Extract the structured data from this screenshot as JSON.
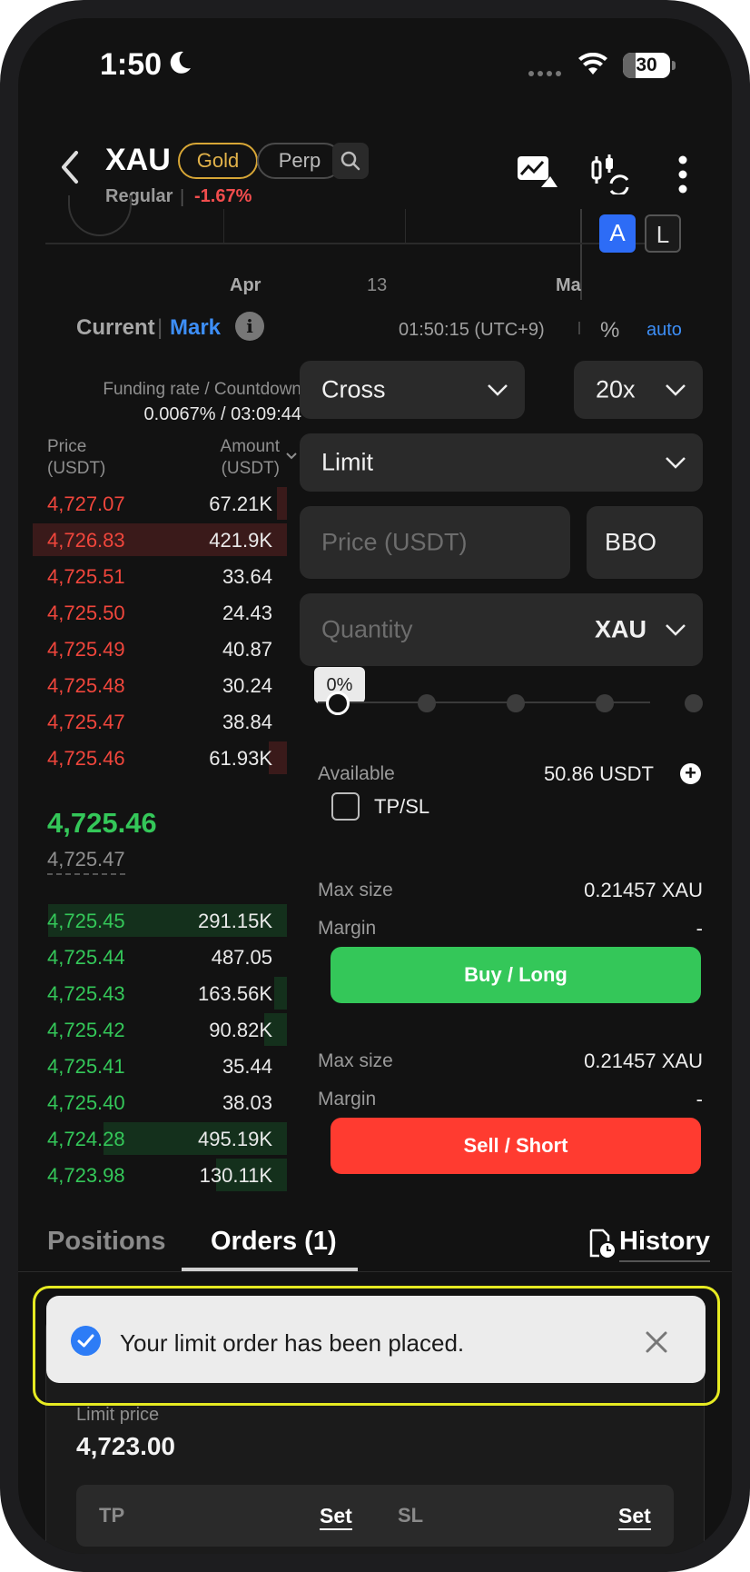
{
  "status_bar": {
    "time": "1:50",
    "battery": "30"
  },
  "header": {
    "symbol": "XAU",
    "tag_gold": "Gold",
    "tag_perp": "Perp",
    "session": "Regular",
    "change": "-1.67%"
  },
  "chart": {
    "x_labels": [
      "Apr",
      "13",
      "Ma"
    ],
    "indicator_a": "A",
    "indicator_l": "L"
  },
  "price_mode": {
    "current": "Current",
    "mark": "Mark",
    "time": "01:50:15 (UTC+9)",
    "percent": "%",
    "auto": "auto"
  },
  "orderbook": {
    "funding_title": "Funding rate / Countdown",
    "funding_value": "0.0067% / 03:09:44",
    "col_price": [
      "Price",
      "(USDT)"
    ],
    "col_amount": [
      "Amount",
      "(USDT)"
    ],
    "asks": [
      {
        "price": "4,727.07",
        "amount": "67.21K",
        "depth": 0.04
      },
      {
        "price": "4,726.83",
        "amount": "421.9K",
        "depth": 1.0
      },
      {
        "price": "4,725.51",
        "amount": "33.64",
        "depth": 0.0
      },
      {
        "price": "4,725.50",
        "amount": "24.43",
        "depth": 0.0
      },
      {
        "price": "4,725.49",
        "amount": "40.87",
        "depth": 0.0
      },
      {
        "price": "4,725.48",
        "amount": "30.24",
        "depth": 0.0
      },
      {
        "price": "4,725.47",
        "amount": "38.84",
        "depth": 0.0
      },
      {
        "price": "4,725.46",
        "amount": "61.93K",
        "depth": 0.07
      }
    ],
    "last_price": "4,725.46",
    "mark_price": "4,725.47",
    "bids": [
      {
        "price": "4,725.45",
        "amount": "291.15K",
        "depth": 0.94
      },
      {
        "price": "4,725.44",
        "amount": "487.05",
        "depth": 0.0
      },
      {
        "price": "4,725.43",
        "amount": "163.56K",
        "depth": 0.05
      },
      {
        "price": "4,725.42",
        "amount": "90.82K",
        "depth": 0.09
      },
      {
        "price": "4,725.41",
        "amount": "35.44",
        "depth": 0.0
      },
      {
        "price": "4,725.40",
        "amount": "38.03",
        "depth": 0.0
      },
      {
        "price": "4,724.28",
        "amount": "495.19K",
        "depth": 0.72
      },
      {
        "price": "4,723.98",
        "amount": "130.11K",
        "depth": 0.28
      }
    ]
  },
  "order_form": {
    "margin_mode": "Cross",
    "leverage": "20x",
    "order_type": "Limit",
    "price_placeholder": "Price (USDT)",
    "bbo": "BBO",
    "quantity_placeholder": "Quantity",
    "quantity_unit": "XAU",
    "slider_percent": "0%",
    "available_label": "Available",
    "available_value": "50.86 USDT",
    "tpsl_label": "TP/SL",
    "buy": {
      "max_size_label": "Max size",
      "max_size_value": "0.21457 XAU",
      "margin_label": "Margin",
      "margin_value": "-",
      "button": "Buy / Long"
    },
    "sell": {
      "max_size_label": "Max size",
      "max_size_value": "0.21457 XAU",
      "margin_label": "Margin",
      "margin_value": "-",
      "button": "Sell / Short"
    }
  },
  "tabs": {
    "positions": "Positions",
    "orders": "Orders (1)",
    "history": "History"
  },
  "order_card": {
    "limit_price_label": "Limit price",
    "limit_price_value": "4,723.00",
    "tp_label": "TP",
    "sl_label": "SL",
    "set": "Set"
  },
  "toast": {
    "message": "Your limit order has been placed."
  },
  "colors": {
    "ask": "#f0463c",
    "bid": "#34c759",
    "accent": "#3d8ef6",
    "gold": "#d7a636"
  }
}
